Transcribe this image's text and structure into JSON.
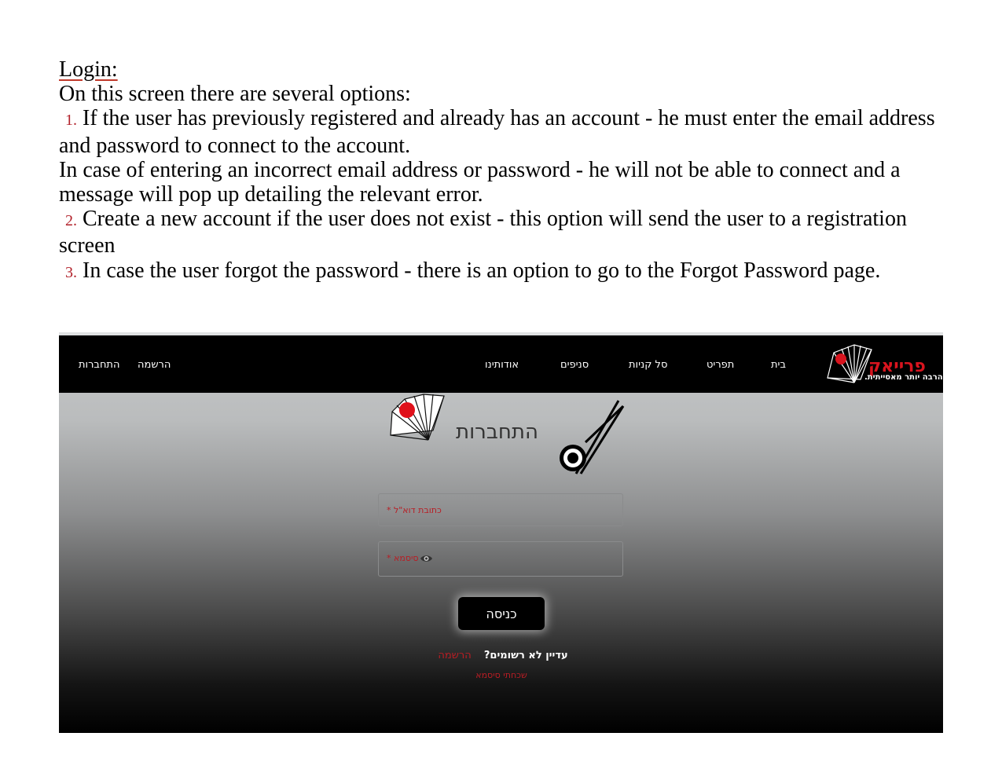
{
  "document": {
    "heading": "Login:",
    "intro": "On this screen there are several options:",
    "items": [
      {
        "num": "1.",
        "text": "If the user has previously registered and already has an account - he must enter the email address and password to connect to the account."
      },
      {
        "num": "2.",
        "text": "Create a new account if the user does not exist - this option will send the user to a registration screen"
      },
      {
        "num": "3.",
        "text": "In case the user forgot the password - there is an option to go to the Forgot Password page."
      }
    ],
    "note": "In case of entering an incorrect email address or password - he will not be able to connect and a message will pop up detailing the relevant error."
  },
  "site": {
    "nav": {
      "login": "התחברות",
      "register": "הרשמה",
      "about": "אודותינו",
      "branches": "סניפים",
      "cart": "סל קניות",
      "menu": "תפריט",
      "home": "בית"
    },
    "logo": {
      "name": "פרייאק",
      "tagline": "הרבה יותר מאסייתית."
    },
    "page_title": "התחברות",
    "email_placeholder": "כתובת דוא\"ל *",
    "password_placeholder": "סיסמא *",
    "login_button": "כניסה",
    "not_registered": "עדיין לא רשומים?",
    "register_link": "הרשמה",
    "forgot_link": "שכחתי סיסמא"
  },
  "colors": {
    "accent_red": "#b81d24",
    "navbar": "#000000"
  }
}
